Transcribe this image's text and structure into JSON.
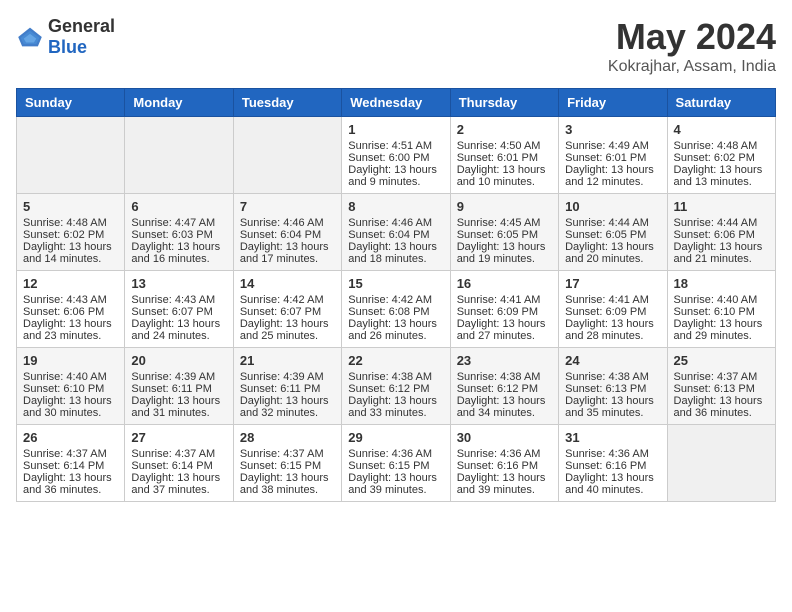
{
  "header": {
    "logo_general": "General",
    "logo_blue": "Blue",
    "title": "May 2024",
    "location": "Kokrajhar, Assam, India"
  },
  "days_of_week": [
    "Sunday",
    "Monday",
    "Tuesday",
    "Wednesday",
    "Thursday",
    "Friday",
    "Saturday"
  ],
  "weeks": [
    [
      {
        "day": "",
        "data": ""
      },
      {
        "day": "",
        "data": ""
      },
      {
        "day": "",
        "data": ""
      },
      {
        "day": "1",
        "sunrise": "Sunrise: 4:51 AM",
        "sunset": "Sunset: 6:00 PM",
        "daylight": "Daylight: 13 hours and 9 minutes."
      },
      {
        "day": "2",
        "sunrise": "Sunrise: 4:50 AM",
        "sunset": "Sunset: 6:01 PM",
        "daylight": "Daylight: 13 hours and 10 minutes."
      },
      {
        "day": "3",
        "sunrise": "Sunrise: 4:49 AM",
        "sunset": "Sunset: 6:01 PM",
        "daylight": "Daylight: 13 hours and 12 minutes."
      },
      {
        "day": "4",
        "sunrise": "Sunrise: 4:48 AM",
        "sunset": "Sunset: 6:02 PM",
        "daylight": "Daylight: 13 hours and 13 minutes."
      }
    ],
    [
      {
        "day": "5",
        "sunrise": "Sunrise: 4:48 AM",
        "sunset": "Sunset: 6:02 PM",
        "daylight": "Daylight: 13 hours and 14 minutes."
      },
      {
        "day": "6",
        "sunrise": "Sunrise: 4:47 AM",
        "sunset": "Sunset: 6:03 PM",
        "daylight": "Daylight: 13 hours and 16 minutes."
      },
      {
        "day": "7",
        "sunrise": "Sunrise: 4:46 AM",
        "sunset": "Sunset: 6:04 PM",
        "daylight": "Daylight: 13 hours and 17 minutes."
      },
      {
        "day": "8",
        "sunrise": "Sunrise: 4:46 AM",
        "sunset": "Sunset: 6:04 PM",
        "daylight": "Daylight: 13 hours and 18 minutes."
      },
      {
        "day": "9",
        "sunrise": "Sunrise: 4:45 AM",
        "sunset": "Sunset: 6:05 PM",
        "daylight": "Daylight: 13 hours and 19 minutes."
      },
      {
        "day": "10",
        "sunrise": "Sunrise: 4:44 AM",
        "sunset": "Sunset: 6:05 PM",
        "daylight": "Daylight: 13 hours and 20 minutes."
      },
      {
        "day": "11",
        "sunrise": "Sunrise: 4:44 AM",
        "sunset": "Sunset: 6:06 PM",
        "daylight": "Daylight: 13 hours and 21 minutes."
      }
    ],
    [
      {
        "day": "12",
        "sunrise": "Sunrise: 4:43 AM",
        "sunset": "Sunset: 6:06 PM",
        "daylight": "Daylight: 13 hours and 23 minutes."
      },
      {
        "day": "13",
        "sunrise": "Sunrise: 4:43 AM",
        "sunset": "Sunset: 6:07 PM",
        "daylight": "Daylight: 13 hours and 24 minutes."
      },
      {
        "day": "14",
        "sunrise": "Sunrise: 4:42 AM",
        "sunset": "Sunset: 6:07 PM",
        "daylight": "Daylight: 13 hours and 25 minutes."
      },
      {
        "day": "15",
        "sunrise": "Sunrise: 4:42 AM",
        "sunset": "Sunset: 6:08 PM",
        "daylight": "Daylight: 13 hours and 26 minutes."
      },
      {
        "day": "16",
        "sunrise": "Sunrise: 4:41 AM",
        "sunset": "Sunset: 6:09 PM",
        "daylight": "Daylight: 13 hours and 27 minutes."
      },
      {
        "day": "17",
        "sunrise": "Sunrise: 4:41 AM",
        "sunset": "Sunset: 6:09 PM",
        "daylight": "Daylight: 13 hours and 28 minutes."
      },
      {
        "day": "18",
        "sunrise": "Sunrise: 4:40 AM",
        "sunset": "Sunset: 6:10 PM",
        "daylight": "Daylight: 13 hours and 29 minutes."
      }
    ],
    [
      {
        "day": "19",
        "sunrise": "Sunrise: 4:40 AM",
        "sunset": "Sunset: 6:10 PM",
        "daylight": "Daylight: 13 hours and 30 minutes."
      },
      {
        "day": "20",
        "sunrise": "Sunrise: 4:39 AM",
        "sunset": "Sunset: 6:11 PM",
        "daylight": "Daylight: 13 hours and 31 minutes."
      },
      {
        "day": "21",
        "sunrise": "Sunrise: 4:39 AM",
        "sunset": "Sunset: 6:11 PM",
        "daylight": "Daylight: 13 hours and 32 minutes."
      },
      {
        "day": "22",
        "sunrise": "Sunrise: 4:38 AM",
        "sunset": "Sunset: 6:12 PM",
        "daylight": "Daylight: 13 hours and 33 minutes."
      },
      {
        "day": "23",
        "sunrise": "Sunrise: 4:38 AM",
        "sunset": "Sunset: 6:12 PM",
        "daylight": "Daylight: 13 hours and 34 minutes."
      },
      {
        "day": "24",
        "sunrise": "Sunrise: 4:38 AM",
        "sunset": "Sunset: 6:13 PM",
        "daylight": "Daylight: 13 hours and 35 minutes."
      },
      {
        "day": "25",
        "sunrise": "Sunrise: 4:37 AM",
        "sunset": "Sunset: 6:13 PM",
        "daylight": "Daylight: 13 hours and 36 minutes."
      }
    ],
    [
      {
        "day": "26",
        "sunrise": "Sunrise: 4:37 AM",
        "sunset": "Sunset: 6:14 PM",
        "daylight": "Daylight: 13 hours and 36 minutes."
      },
      {
        "day": "27",
        "sunrise": "Sunrise: 4:37 AM",
        "sunset": "Sunset: 6:14 PM",
        "daylight": "Daylight: 13 hours and 37 minutes."
      },
      {
        "day": "28",
        "sunrise": "Sunrise: 4:37 AM",
        "sunset": "Sunset: 6:15 PM",
        "daylight": "Daylight: 13 hours and 38 minutes."
      },
      {
        "day": "29",
        "sunrise": "Sunrise: 4:36 AM",
        "sunset": "Sunset: 6:15 PM",
        "daylight": "Daylight: 13 hours and 39 minutes."
      },
      {
        "day": "30",
        "sunrise": "Sunrise: 4:36 AM",
        "sunset": "Sunset: 6:16 PM",
        "daylight": "Daylight: 13 hours and 39 minutes."
      },
      {
        "day": "31",
        "sunrise": "Sunrise: 4:36 AM",
        "sunset": "Sunset: 6:16 PM",
        "daylight": "Daylight: 13 hours and 40 minutes."
      },
      {
        "day": "",
        "data": ""
      }
    ]
  ]
}
